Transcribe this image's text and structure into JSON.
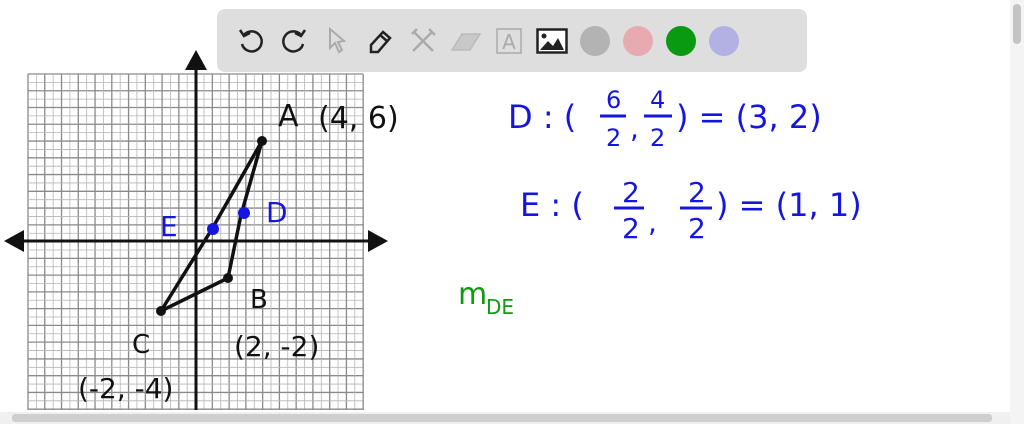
{
  "toolbar": {
    "tools": [
      {
        "name": "undo-icon"
      },
      {
        "name": "redo-icon"
      },
      {
        "name": "select-icon"
      },
      {
        "name": "pen-icon"
      },
      {
        "name": "tools-icon"
      },
      {
        "name": "eraser-icon"
      },
      {
        "name": "text-icon",
        "glyph": "A"
      },
      {
        "name": "image-icon"
      }
    ],
    "colors": [
      "#b3b3b3",
      "#e6aab0",
      "#0a9a12",
      "#b3b0e3"
    ]
  },
  "board": {
    "points": {
      "A": {
        "label": "A",
        "coord": "(4, 6)"
      },
      "B": {
        "label": "B",
        "coord": "(2, -2)"
      },
      "C": {
        "label": "C",
        "coord": "(-2, -4)"
      },
      "D": {
        "label": "D"
      },
      "E": {
        "label": "E"
      }
    },
    "work": {
      "d_line_prefix": "D : (",
      "d_num1": "6",
      "d_den1": "2",
      "d_num2": "4",
      "d_den2": "2",
      "d_result": ") = (3, 2)",
      "e_line_prefix": "E : (",
      "e_num1": "2",
      "e_den1": "2",
      "e_num2": "2",
      "e_den2": "2",
      "e_result": ") = (1, 1)",
      "slope_m": "m",
      "slope_sub": "DE"
    },
    "ink_colors": {
      "black": "#111111",
      "blue": "#1515e0",
      "green": "#139a13"
    }
  }
}
